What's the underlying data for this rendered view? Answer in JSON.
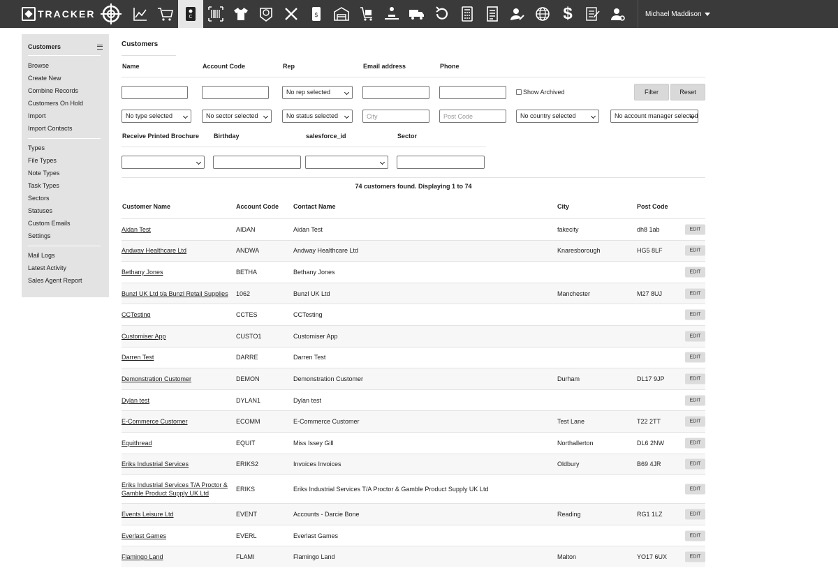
{
  "header": {
    "logo_text": "TRACKER",
    "user_name": "Michael Maddison",
    "nav_icons": [
      "target-icon",
      "chart-icon",
      "cart-icon",
      "contacts-book-icon",
      "barcode-icon",
      "shirt-icon",
      "lifebuoy-icon",
      "tools-icon",
      "phone-money-icon",
      "warehouse-icon",
      "trolley-icon",
      "conveyor-icon",
      "delivery-truck-icon",
      "returns-icon",
      "calculator-icon",
      "invoice-icon",
      "user-edit-icon",
      "globe-icon",
      "dollar-icon",
      "report-clipboard-icon",
      "user-settings-icon"
    ]
  },
  "sidebar": {
    "title": "Customers",
    "groups": [
      [
        "Browse",
        "Create New",
        "Combine Records",
        "Customers On Hold",
        "Import",
        "Import Contacts"
      ],
      [
        "Types",
        "File Types",
        "Note Types",
        "Task Types",
        "Sectors",
        "Statuses",
        "Custom Emails",
        "Settings"
      ],
      [
        "Mail Logs",
        "Latest Activity",
        "Sales Agent Report"
      ]
    ]
  },
  "page": {
    "title": "Customers"
  },
  "filters": {
    "labels": {
      "name": "Name",
      "account_code": "Account Code",
      "rep": "Rep",
      "email": "Email address",
      "phone": "Phone",
      "brochure": "Receive Printed Brochure",
      "birthday": "Birthday",
      "salesforce": "salesforce_id",
      "sector": "Sector"
    },
    "rep_select": "No rep selected",
    "show_archived": "Show Archived",
    "filter_btn": "Filter",
    "reset_btn": "Reset",
    "type_select": "No type selected",
    "sector_select": "No sector selected",
    "status_select": "No status selected",
    "city_placeholder": "City",
    "postcode_placeholder": "Post Code",
    "country_select": "No country selected",
    "manager_select": "No account manager selected"
  },
  "results_text": "74 customers found. Displaying 1 to 74",
  "table": {
    "headers": {
      "name": "Customer Name",
      "code": "Account Code",
      "contact": "Contact Name",
      "city": "City",
      "post": "Post Code"
    },
    "edit_label": "EDIT",
    "rows": [
      {
        "name": "Aidan Test",
        "code": "AIDAN",
        "contact": "Aidan Test",
        "city": "fakecity",
        "post": "dh8 1ab"
      },
      {
        "name": "Andway Healthcare Ltd",
        "code": "ANDWA",
        "contact": "Andway Healthcare Ltd",
        "city": "Knaresborough",
        "post": "HG5 8LF"
      },
      {
        "name": "Bethany Jones",
        "code": "BETHA",
        "contact": "Bethany Jones",
        "city": "",
        "post": ""
      },
      {
        "name": "Bunzl UK Ltd t/a Bunzl Retail Supplies",
        "code": "1062",
        "contact": "Bunzl UK Ltd",
        "city": "Manchester",
        "post": "M27 8UJ"
      },
      {
        "name": "CCTesting",
        "code": "CCTES",
        "contact": "CCTesting",
        "city": "",
        "post": ""
      },
      {
        "name": "Customiser App",
        "code": "CUSTO1",
        "contact": "Customiser App",
        "city": "",
        "post": ""
      },
      {
        "name": "Darren Test",
        "code": "DARRE",
        "contact": "Darren Test",
        "city": "",
        "post": ""
      },
      {
        "name": "Demonstration Customer",
        "code": "DEMON",
        "contact": "Demonstration Customer",
        "city": "Durham",
        "post": "DL17 9JP"
      },
      {
        "name": "Dylan test",
        "code": "DYLAN1",
        "contact": "Dylan test",
        "city": "",
        "post": ""
      },
      {
        "name": "E-Commerce Customer",
        "code": "ECOMM",
        "contact": "E-Commerce Customer",
        "city": "Test Lane",
        "post": "T22 2TT"
      },
      {
        "name": "Equithread",
        "code": "EQUIT",
        "contact": "Miss Issey Gill",
        "city": "Northallerton",
        "post": "DL6 2NW"
      },
      {
        "name": "Eriks Industrial Services",
        "code": "ERIKS2",
        "contact": "Invoices Invoices",
        "city": "Oldbury",
        "post": "B69 4JR"
      },
      {
        "name": "Eriks Industrial Services T/A Proctor & Gamble Product Supply UK Ltd",
        "code": "ERIKS",
        "contact": "Eriks Industrial Services T/A Proctor & Gamble Product Supply UK Ltd",
        "city": "",
        "post": ""
      },
      {
        "name": "Events Leisure Ltd",
        "code": "EVENT",
        "contact": "Accounts - Darcie Bone",
        "city": "Reading",
        "post": "RG1 1LZ"
      },
      {
        "name": "Everlast Games",
        "code": "EVERL",
        "contact": "Everlast Games",
        "city": "",
        "post": ""
      },
      {
        "name": "Flamingo Land",
        "code": "FLAMI",
        "contact": "Flamingo Land",
        "city": "Malton",
        "post": "YO17 6UX"
      }
    ]
  }
}
